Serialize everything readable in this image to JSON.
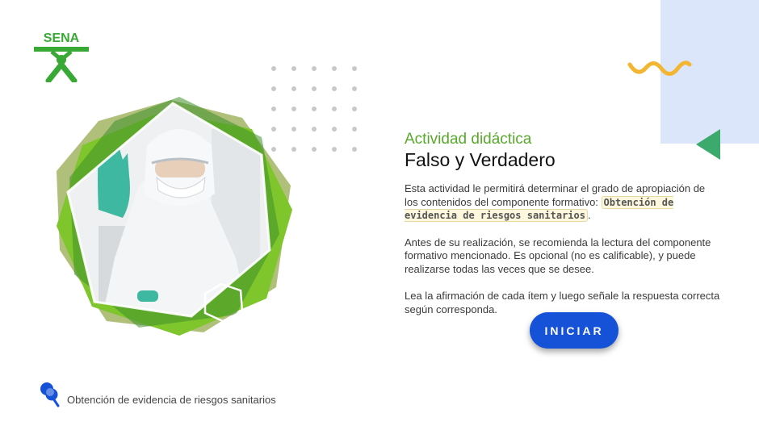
{
  "brand": {
    "name": "SENA",
    "color": "#39a935"
  },
  "activity": {
    "eyebrow": "Actividad didáctica",
    "title": "Falso y Verdadero",
    "intro_before": "Esta actividad le permitirá determinar el grado de apropiación de los contenidos del componente formativo: ",
    "component_highlight": "Obtención de evidencia de riesgos sanitarios",
    "intro_after": ".",
    "paragraph_2": "Antes de su realización, se recomienda la lectura del componente formativo mencionado. Es opcional (no es calificable), y puede realizarse todas las veces que se desee.",
    "paragraph_3": "Lea la afirmación de cada ítem y luego señale la respuesta correcta según corresponda."
  },
  "start_button": {
    "label": "INICIAR"
  },
  "footer": {
    "label": "Obtención de evidencia de riesgos sanitarios",
    "icon": "pushpin-icon"
  },
  "colors": {
    "accent_blue": "#1552d8",
    "green_title": "#59a92c",
    "deco_blue": "#dce6fb",
    "deco_yellow": "#f2b632",
    "deco_green": "#3daa6d"
  }
}
